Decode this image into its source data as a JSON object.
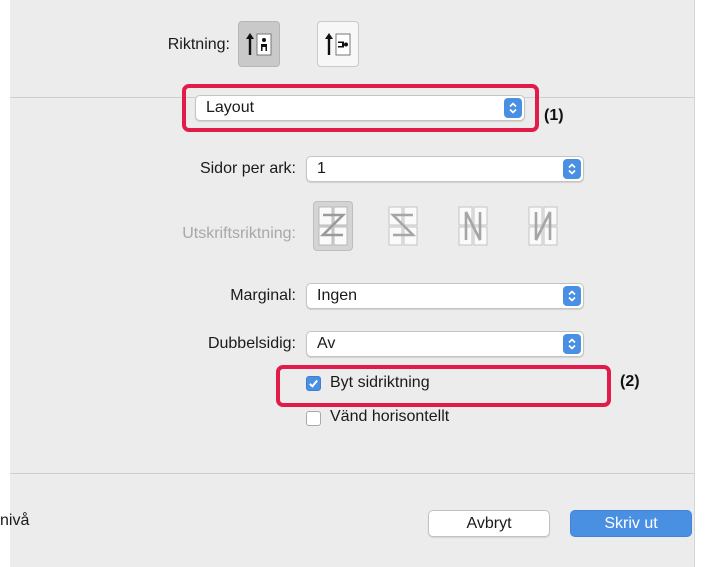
{
  "orientation": {
    "label": "Riktning:",
    "options": [
      {
        "name": "portrait",
        "selected": true
      },
      {
        "name": "landscape",
        "selected": false
      }
    ]
  },
  "panel_select": {
    "value": "Layout"
  },
  "layout": {
    "pages_per_sheet": {
      "label": "Sidor per ark:",
      "value": "1"
    },
    "layout_direction": {
      "label": "Utskriftsriktning:",
      "enabled": false,
      "options": [
        "z-direction",
        "reverse-s-direction",
        "n-reverse-direction",
        "n-direction"
      ],
      "selected_index": 0
    },
    "border": {
      "label": "Marginal:",
      "value": "Ingen"
    },
    "two_sided": {
      "label": "Dubbelsidig:",
      "value": "Av"
    },
    "reverse_orientation": {
      "label": "Byt sidriktning",
      "checked": true
    },
    "flip_horizontally": {
      "label": "Vänd horisontellt",
      "checked": false
    }
  },
  "callouts": {
    "one": "(1)",
    "two": "(2)"
  },
  "footer": {
    "partial_text": "nivå",
    "cancel_label": "Avbryt",
    "print_label": "Skriv ut"
  },
  "colors": {
    "accent": "#4a90e2",
    "highlight": "#e21c4a",
    "panel": "#ececec"
  }
}
